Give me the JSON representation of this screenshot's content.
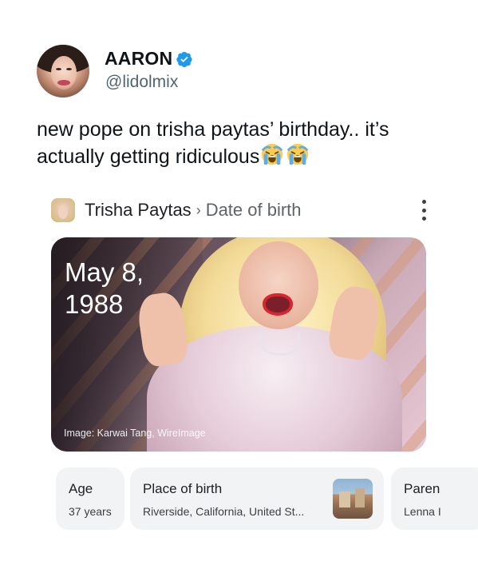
{
  "tweet": {
    "display_name": "AARON",
    "handle": "@lidolmix",
    "text": "new pope on trisha paytas’ birthday.. it’s actually getting ridiculous",
    "emoji": [
      "crying-face-emoji",
      "crying-face-emoji"
    ],
    "verified_color": "#1d9bf0"
  },
  "card": {
    "title": "Trisha Paytas",
    "separator": "›",
    "subtitle": "Date of birth",
    "date_line1": "May 8,",
    "date_line2": "1988",
    "image_credit": "Image: Karwai Tang, WireImage"
  },
  "facts": [
    {
      "label": "Age",
      "value": "37 years"
    },
    {
      "label": "Place of birth",
      "value": "Riverside, California, United St..."
    },
    {
      "label": "Paren",
      "value": "Lenna I"
    }
  ]
}
